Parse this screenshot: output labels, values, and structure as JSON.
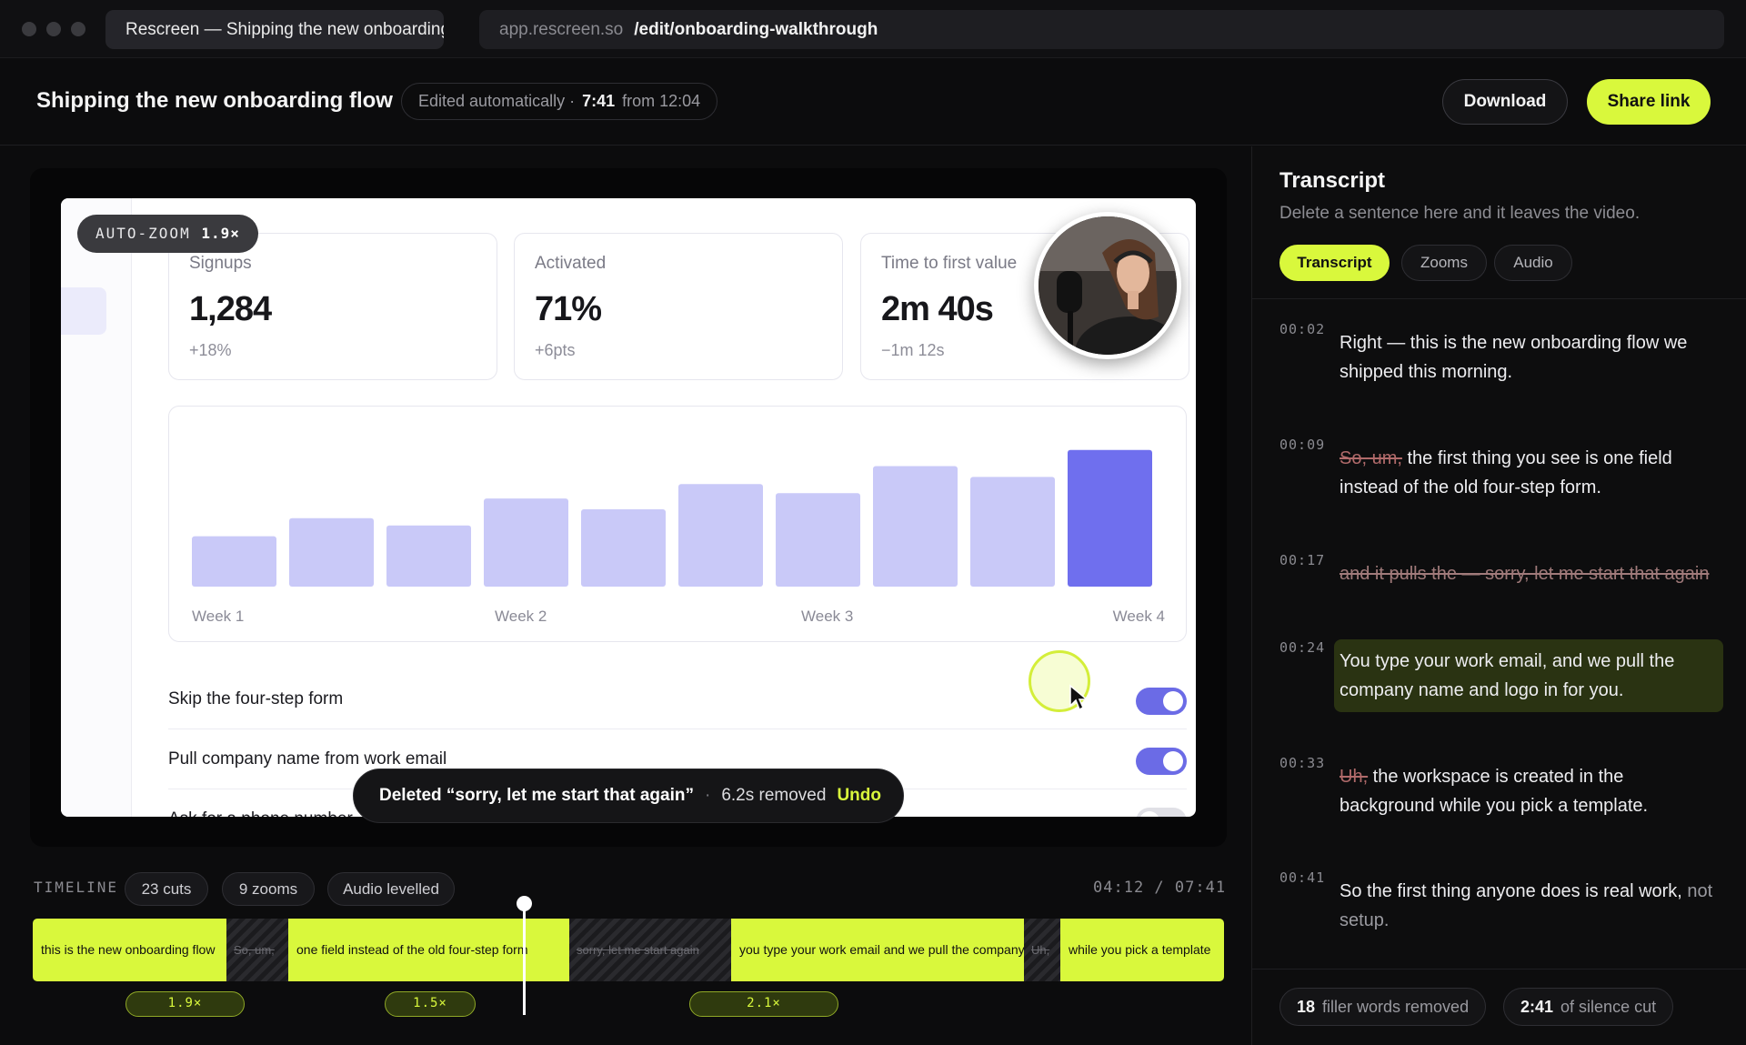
{
  "browser": {
    "tab_title": "Rescreen — Shipping the new onboarding",
    "url_host": "app.rescreen.so",
    "url_path": "/edit/onboarding-walkthrough"
  },
  "header": {
    "title": "Shipping the new onboarding flow",
    "edit_prefix": "Edited automatically ·",
    "edit_duration": "7:41",
    "edit_from": "from 12:04",
    "download_label": "Download",
    "share_label": "Share link"
  },
  "video": {
    "autozoom_label": "AUTO-ZOOM",
    "autozoom_value": "1.9×",
    "kpis": [
      {
        "label": "Signups",
        "value": "1,284",
        "delta": "+18%"
      },
      {
        "label": "Activated",
        "value": "71%",
        "delta": "+6pts"
      },
      {
        "label": "Time to first value",
        "value": "2m 40s",
        "delta": "−1m 12s"
      }
    ],
    "toggles": [
      {
        "label": "Skip the four-step form",
        "on": true
      },
      {
        "label": "Pull company name from work email",
        "on": true
      },
      {
        "label": "Ask for a phone number",
        "on": false
      }
    ],
    "toast": {
      "message": "Deleted “sorry, let me start that again”",
      "removed": "6.2s removed",
      "undo_label": "Undo"
    }
  },
  "chart_data": {
    "type": "bar",
    "values": [
      28,
      38,
      34,
      49,
      43,
      57,
      52,
      67,
      61,
      76
    ],
    "ylim": [
      0,
      90
    ],
    "x_tick_labels": [
      "Week 1",
      "Week 2",
      "Week 3",
      "Week 4"
    ],
    "highlight_index": 9,
    "colors": {
      "bar": "#c9c9f8",
      "highlight": "#6f6fee"
    }
  },
  "timeline": {
    "label": "TIMELINE",
    "chips": [
      "23 cuts",
      "9 zooms",
      "Audio levelled"
    ],
    "time": "04:12 / 07:41",
    "segments": [
      {
        "kind": "clip",
        "text": "this is the new onboarding flow"
      },
      {
        "kind": "cut",
        "text": "So, um,"
      },
      {
        "kind": "clip",
        "text": "one field instead of the old four-step form"
      },
      {
        "kind": "cut",
        "text": "sorry, let me start again"
      },
      {
        "kind": "clip",
        "text": "you type your work email and we pull the company"
      },
      {
        "kind": "cut",
        "text": "Uh,"
      },
      {
        "kind": "clip",
        "text": "while you pick a template"
      }
    ],
    "zooms": [
      "1.9×",
      "1.5×",
      "2.1×"
    ],
    "playhead_fraction": 0.5454
  },
  "transcript": {
    "title": "Transcript",
    "subtitle": "Delete a sentence here and it leaves the video.",
    "tabs": [
      "Transcript",
      "Zooms",
      "Audio"
    ],
    "entries": [
      {
        "ts": "00:02",
        "text": "Right — this is the new onboarding flow we shipped this morning."
      },
      {
        "ts": "00:09",
        "filler": "So, um,",
        "text": " the first thing you see is one field instead of the old four-step form."
      },
      {
        "ts": "00:17",
        "struck": "and it pulls the — sorry, let me start that again"
      },
      {
        "ts": "00:24",
        "text": "You type your work email, and we pull the company name and logo in for you."
      },
      {
        "ts": "00:33",
        "filler": "Uh,",
        "text": " the workspace is created in the background while you pick a template."
      },
      {
        "ts": "00:41",
        "text": "So the first thing anyone does is real work, ",
        "dim": "not setup."
      }
    ],
    "stats": [
      {
        "value": "18",
        "label": "filler words removed"
      },
      {
        "value": "2:41",
        "label": "of silence cut"
      }
    ]
  },
  "colors": {
    "accent": "#d9f83c",
    "brand_violet": "#6f6fee"
  }
}
